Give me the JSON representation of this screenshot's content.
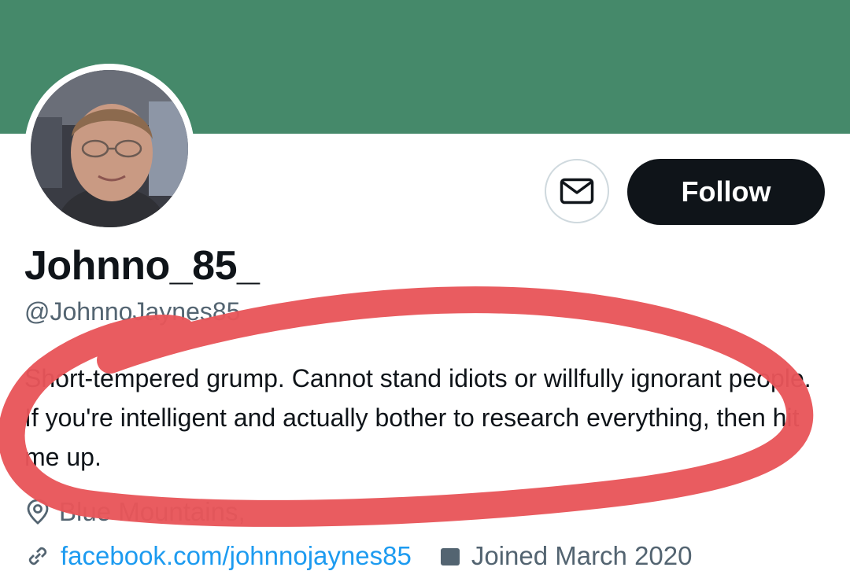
{
  "colors": {
    "banner": "#45896a",
    "follow_bg": "#0f1419",
    "follow_text": "#ffffff",
    "secondary_text": "#536471",
    "link": "#1d9bf0",
    "annotation": "#e8555a"
  },
  "profile": {
    "display_name": "Johnno_85_",
    "handle": "@JohnnoJaynes85",
    "bio": "Short-tempered grump. Cannot stand idiots or willfully ignorant people. If you're intelligent and actually bother to research everything, then hit me up.",
    "location": "Blue Mountains,",
    "website": "facebook.com/johnnojaynes85",
    "joined": "Joined March 2020"
  },
  "actions": {
    "message_icon": "envelope-icon",
    "follow_label": "Follow"
  },
  "icons": {
    "location": "location-pin-icon",
    "link": "link-icon",
    "joined": "calendar-icon"
  }
}
